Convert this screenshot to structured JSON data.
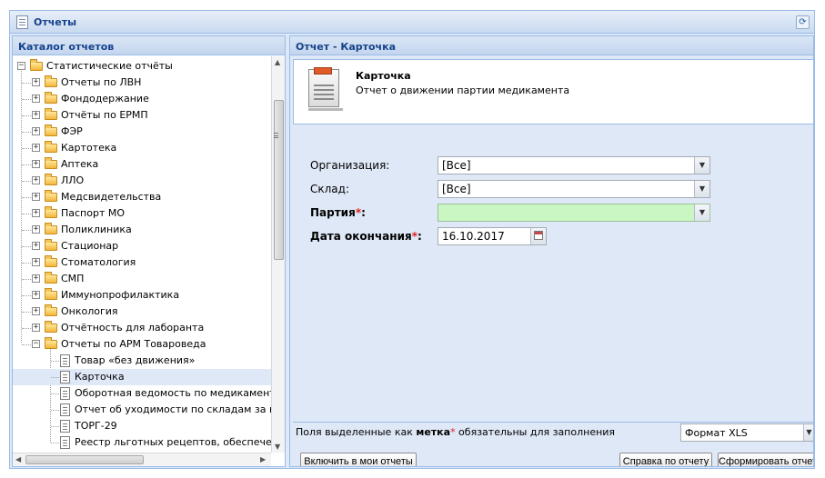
{
  "window": {
    "title": "Отчеты"
  },
  "catalog": {
    "title": "Каталог отчетов",
    "root": "Статистические отчёты",
    "folders": [
      "Отчеты по ЛВН",
      "Фондодержание",
      "Отчёты по ЕРМП",
      "ФЭР",
      "Картотека",
      "Аптека",
      "ЛЛО",
      "Медсвидетельства",
      "Паспорт МО",
      "Поликлиника",
      "Стационар",
      "Стоматология",
      "СМП",
      "Иммунопрофилактика",
      "Онкология",
      "Отчётность для лаборанта",
      "Отчеты по АРМ Товароведа"
    ],
    "reports": [
      "Товар «без движения»",
      "Карточка",
      "Оборотная ведомость по медикаментам",
      "Отчет об уходимости по складам за пери",
      "ТОРГ-29",
      "Реестр льготных рецептов, обеспеченны"
    ],
    "selected_report": "Карточка"
  },
  "report": {
    "panel_title": "Отчет - Карточка",
    "card_title": "Карточка",
    "card_subtitle": "Отчет о движении партии медикамента",
    "fields": {
      "organization": {
        "label": "Организация:",
        "value": "[Все]"
      },
      "warehouse": {
        "label": "Склад:",
        "value": "[Все]"
      },
      "batch": {
        "label": "Партия",
        "required_mark": "*",
        "suffix": ":",
        "value": ""
      },
      "end_date": {
        "label": "Дата окончания",
        "required_mark": "*",
        "suffix": ":",
        "value": "16.10.2017"
      }
    },
    "footer": {
      "note_before": "Поля выделенные как ",
      "note_bold": "метка",
      "note_mark": "*",
      "note_after": " обязательны для заполнения",
      "format_value": "Формат XLS"
    },
    "buttons": {
      "add_to_my": "Включить в мои отчеты",
      "help": "Справка по отчету",
      "generate": "Сформировать отчет"
    }
  },
  "colors": {
    "header_text": "#15428b",
    "panel_bg": "#dfe8f6",
    "border": "#99bbe8",
    "required_field_bg": "#c9f6c2",
    "required_mark": "#e02020"
  }
}
